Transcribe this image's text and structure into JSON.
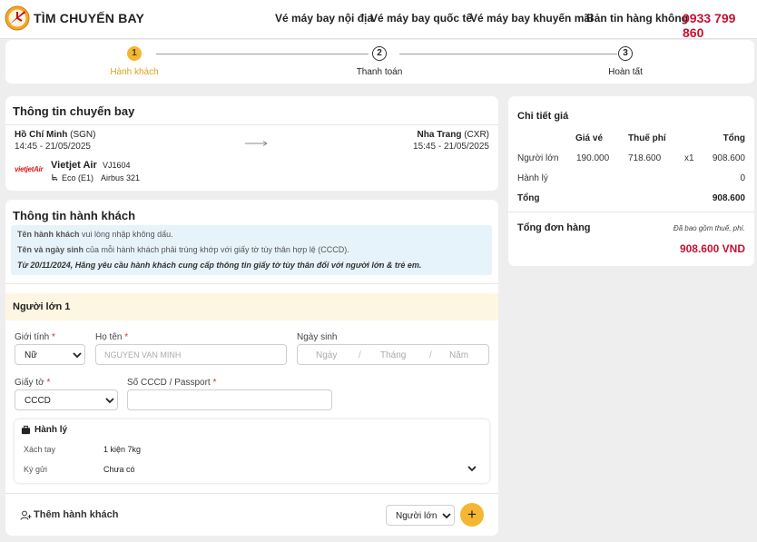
{
  "header": {
    "brand": "TÌM CHUYẾN BAY",
    "nav": [
      "Vé máy bay nội địa",
      "Vé máy bay quốc tế",
      "Vé máy bay khuyến mãi",
      "Bản tin hàng không"
    ],
    "hotline": "0933 799 860"
  },
  "stepper": {
    "steps": [
      {
        "num": "1",
        "label": "Hành khách",
        "active": true
      },
      {
        "num": "2",
        "label": "Thanh toán",
        "active": false
      },
      {
        "num": "3",
        "label": "Hoàn tất",
        "active": false
      }
    ]
  },
  "flight": {
    "title": "Thông tin chuyến bay",
    "from_city": "Hồ Chí Minh",
    "from_code": "(SGN)",
    "depart": "14:45 - 21/05/2025",
    "to_city": "Nha Trang",
    "to_code": "(CXR)",
    "arrive": "15:45 - 21/05/2025",
    "airline_logo": "vietjetAir",
    "airline": "Vietjet Air",
    "flight_no": "VJ1604",
    "fare_class": "Eco (E1)",
    "aircraft": "Airbus 321"
  },
  "passenger": {
    "title": "Thông tin hành khách",
    "notice1_bold": "Tên hành khách",
    "notice1_rest": " vui lòng nhập không dấu.",
    "notice2_bold": "Tên và ngày sinh",
    "notice2_rest": " của mỗi hành khách phải trùng khớp với giấy tờ tùy thân hợp lệ (CCCD).",
    "notice3": "Từ 20/11/2024, Hãng yêu cầu hành khách cung cấp thông tin giấy tờ tùy thân đối với người lớn & trẻ em.",
    "section": "Người lớn 1",
    "gender_label": "Giới tính",
    "gender_value": "Nữ",
    "name_label": "Họ tên",
    "name_placeholder": "NGUYEN VAN MINH",
    "dob_label": "Ngày sinh",
    "dob_day": "Ngày",
    "dob_month": "Tháng",
    "dob_year": "Năm",
    "dob_sep": "/",
    "doc_label": "Giấy tờ",
    "doc_value": "CCCD",
    "id_label": "Số CCCD / Passport",
    "req": "*",
    "baggage_title": "Hành lý",
    "carry_label": "Xách tay",
    "carry_value": "1 kiện 7kg",
    "checked_label": "Ký gửi",
    "checked_value": "Chưa có",
    "add_label": "Thêm hành khách",
    "add_type": "Người lớn",
    "add_button": "+"
  },
  "price": {
    "title": "Chi tiết giá",
    "col_fare": "Giá vé",
    "col_tax": "Thuế phí",
    "col_total": "Tổng",
    "row1_label": "Người lớn",
    "row1_fare": "190.000",
    "row1_tax": "718.600",
    "row1_qty": "x1",
    "row1_total": "908.600",
    "row2_label": "Hành lý",
    "row2_total": "0",
    "row3_label": "Tổng",
    "row3_total": "908.600",
    "grand_label": "Tổng đơn hàng",
    "grand_note": "Đã bao gồm thuế, phí.",
    "grand_value": "908.600 VND"
  },
  "colors": {
    "accent": "#f5b731",
    "hotline": "#c8102e",
    "price": "#c8102e",
    "notice_bg": "#e6f3fb",
    "section_bg": "#fdf6e3"
  }
}
